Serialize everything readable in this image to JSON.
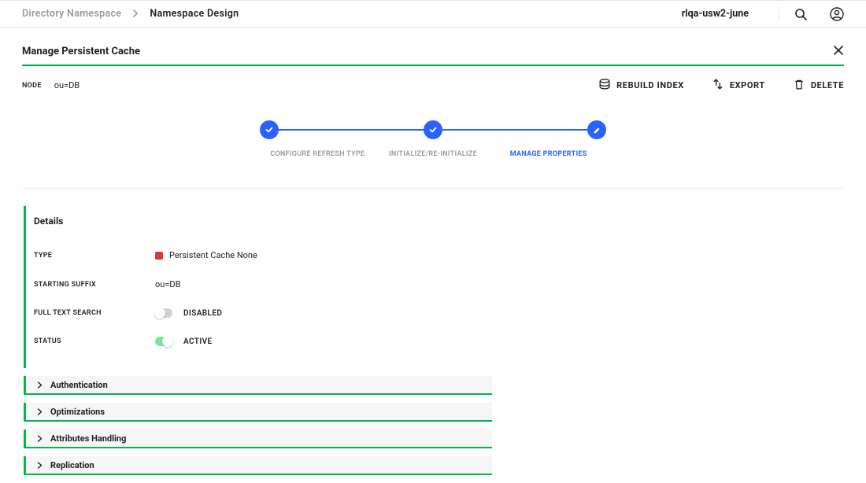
{
  "header": {
    "breadcrumb_parent": "Directory Namespace",
    "breadcrumb_current": "Namespace Design",
    "environment": "rlqa-usw2-june"
  },
  "page": {
    "title": "Manage Persistent Cache"
  },
  "node": {
    "label": "NODE",
    "value": "ou=DB"
  },
  "actions": {
    "rebuild": "REBUILD INDEX",
    "export": "EXPORT",
    "delete": "DELETE"
  },
  "stepper": {
    "steps": [
      {
        "label": "CONFIGURE REFRESH TYPE",
        "state": "done"
      },
      {
        "label": "INITIALIZE/RE-INITIALIZE",
        "state": "done"
      },
      {
        "label": "MANAGE PROPERTIES",
        "state": "active"
      }
    ]
  },
  "details": {
    "title": "Details",
    "type_label": "TYPE",
    "type_value": "Persistent Cache None",
    "suffix_label": "STARTING SUFFIX",
    "suffix_value": "ou=DB",
    "search_label": "FULL TEXT SEARCH",
    "search_state": "DISABLED",
    "status_label": "STATUS",
    "status_state": "ACTIVE"
  },
  "accordions": [
    {
      "title": "Authentication"
    },
    {
      "title": "Optimizations"
    },
    {
      "title": "Attributes Handling"
    },
    {
      "title": "Replication"
    }
  ]
}
